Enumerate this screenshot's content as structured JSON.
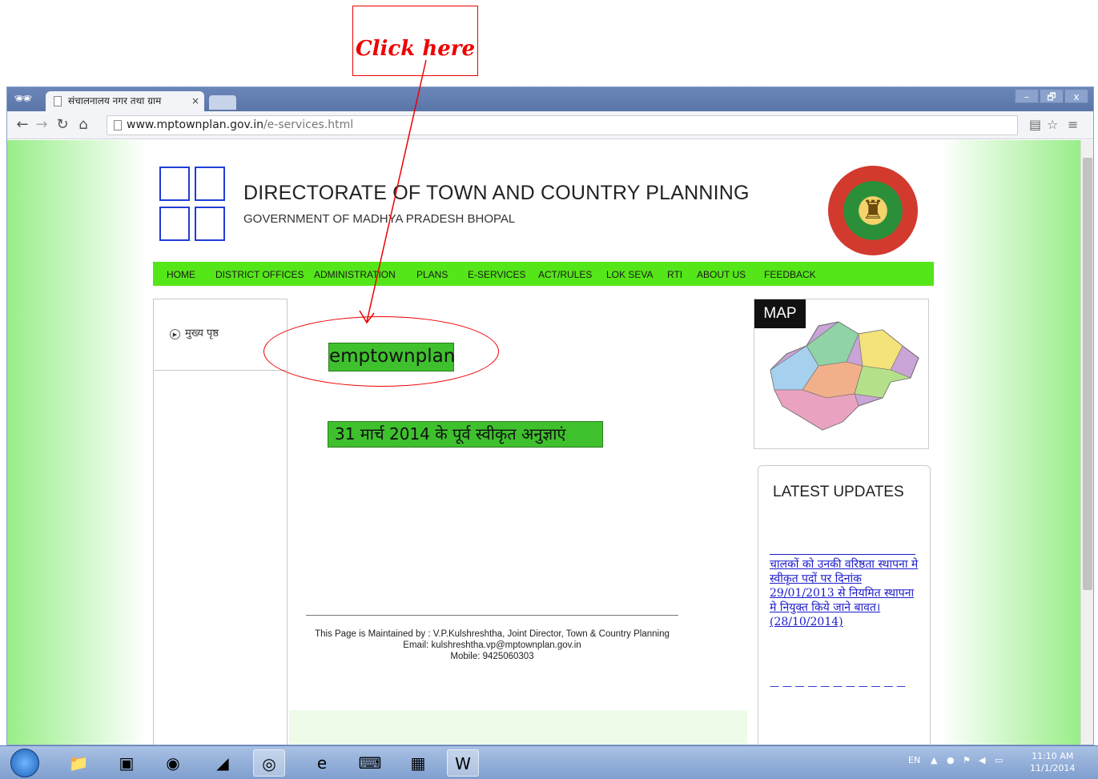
{
  "annotation": {
    "callout_text": "Click here"
  },
  "browser": {
    "tab_title": "संचालनालय नगर तथा ग्राम",
    "tab_close": "×",
    "url_host": "www.mptownplan.gov.in",
    "url_path": "/e-services.html",
    "window_controls": {
      "minimize": "–",
      "maximize": "🗗",
      "close": "x"
    }
  },
  "header": {
    "title": "DIRECTORATE OF TOWN AND COUNTRY PLANNING",
    "subtitle": "GOVERNMENT OF MADHYA PRADESH BHOPAL"
  },
  "menu": [
    "HOME",
    "DISTRICT OFFICES",
    "ADMINISTRATION",
    "PLANS",
    "E-SERVICES",
    "ACT/RULES",
    "LOK SEVA",
    "RTI",
    "ABOUT US",
    "FEEDBACK"
  ],
  "sidebar": {
    "home_link": "मुख्य पृष्ठ"
  },
  "main": {
    "emptownplan_button": "emptownplan",
    "approvals_button": "31 मार्च 2014 के पूर्व स्वीकृत अनुज्ञाएं"
  },
  "footer": {
    "line1": "This Page is Maintained by : V.P.Kulshreshtha, Joint Director, Town & Country Planning",
    "line2": "Email: kulshreshtha.vp@mptownplan.gov.in",
    "line3": "Mobile: 9425060303"
  },
  "map": {
    "label": "MAP"
  },
  "updates": {
    "title": "LATEST UPDATES",
    "item1": "चालकों को उनकी वरिष्ठता स्थापना मे स्वीकृत पदों पर दिनांक 29/01/2013 से नियमित स्थापना मे नियुक्त किये जाने बावत।(28/10/2014)"
  },
  "taskbar": {
    "language": "EN",
    "time": "11:10 AM",
    "date": "11/1/2014"
  },
  "colors": {
    "menu_green": "#55e619",
    "button_green": "#3fc12e",
    "annotation_red": "#ee0000",
    "link_blue": "#1a1acc"
  }
}
